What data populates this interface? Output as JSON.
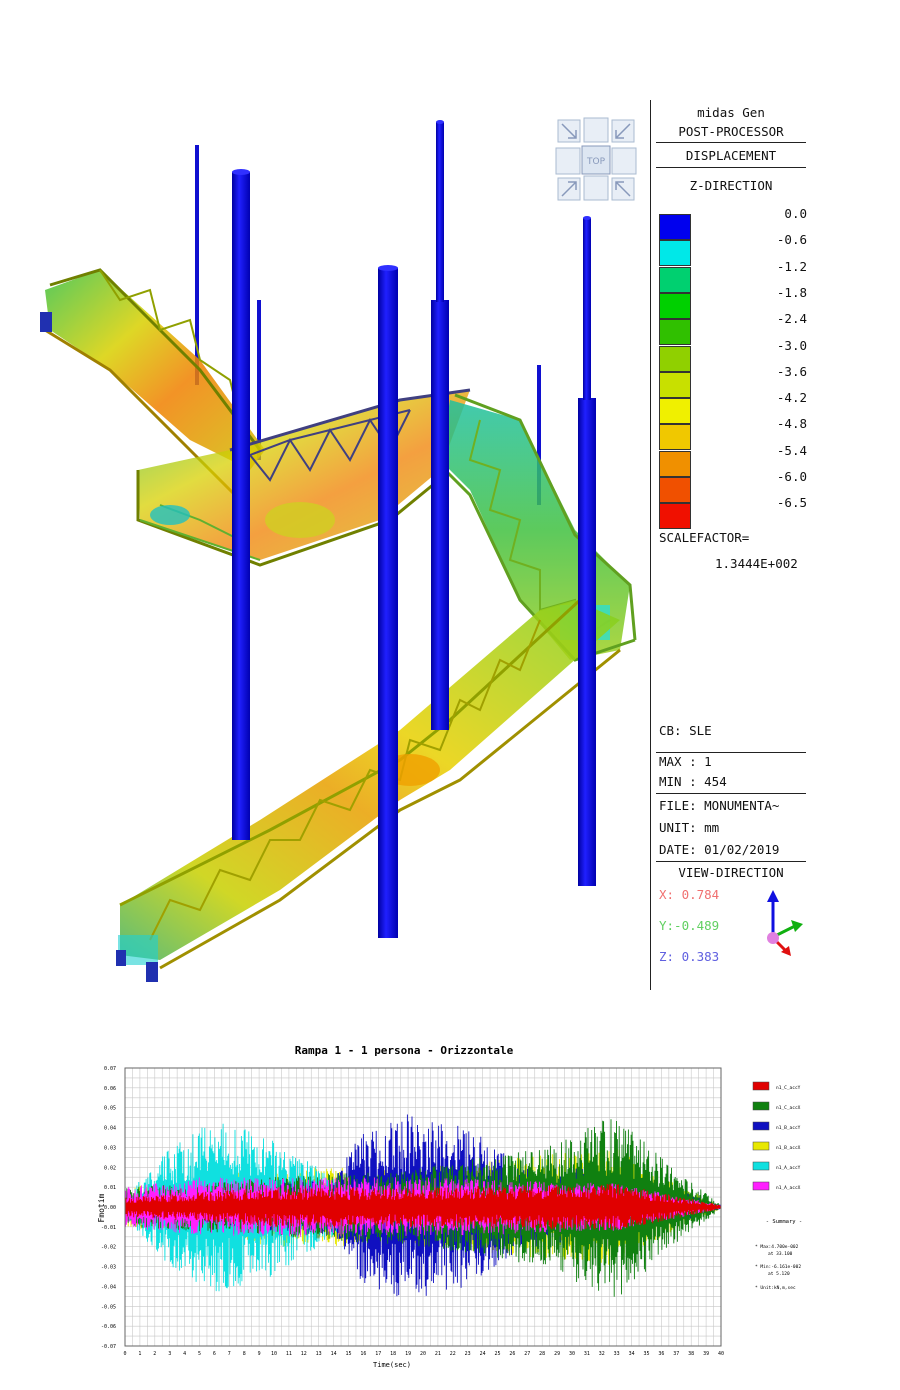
{
  "panel": {
    "app_name": "midas Gen",
    "mode": "POST-PROCESSOR",
    "result_type": "DISPLACEMENT",
    "component": "Z-DIRECTION",
    "contour_values": [
      "0.0",
      "-0.6",
      "-1.2",
      "-1.8",
      "-2.4",
      "-3.0",
      "-3.6",
      "-4.2",
      "-4.8",
      "-5.4",
      "-6.0",
      "-6.5"
    ],
    "contour_colors": [
      "#0000ee",
      "#00e8e8",
      "#00d070",
      "#00d000",
      "#30c000",
      "#90d000",
      "#c8e000",
      "#f0f000",
      "#f0c800",
      "#f09000",
      "#f05000",
      "#f01000"
    ],
    "scalefactor_label": "SCALEFACTOR=",
    "scalefactor_value": "1.3444E+002",
    "cb": "CB: SLE",
    "max": "MAX : 1",
    "min": "MIN : 454",
    "file": "FILE: MONUMENTA~",
    "unit": "UNIT: mm",
    "date": "DATE: 01/02/2019",
    "view_direction": "VIEW-DIRECTION",
    "view_x": "X: 0.784",
    "view_y": "Y:-0.489",
    "view_z": "Z: 0.383",
    "view_cube_label": "TOP"
  },
  "chart_data": {
    "type": "line",
    "title": "Rampa 1 - 1 persona - Orizzontale",
    "xlabel": "Time(sec)",
    "ylabel": "Fmotim",
    "xlim": [
      0,
      40
    ],
    "ylim": [
      -0.07,
      0.07
    ],
    "x_ticks": [
      "0",
      "1",
      "2",
      "3",
      "4",
      "5",
      "6",
      "7",
      "8",
      "9",
      "10",
      "11",
      "12",
      "13",
      "14",
      "15",
      "16",
      "17",
      "18",
      "19",
      "20",
      "21",
      "22",
      "23",
      "24",
      "25",
      "26",
      "27",
      "28",
      "29",
      "30",
      "31",
      "32",
      "33",
      "34",
      "35",
      "36",
      "37",
      "38",
      "39",
      "40"
    ],
    "y_ticks": [
      "0.07",
      "0.06",
      "0.05",
      "0.04",
      "0.03",
      "0.02",
      "0.01",
      "0.00",
      "-0.01",
      "-0.02",
      "-0.03",
      "-0.04",
      "-0.05",
      "-0.06",
      "-0.07"
    ],
    "series": [
      {
        "name": "n1_C_accY",
        "color": "#e00000",
        "envelope": [
          [
            0,
            0.005
          ],
          [
            10,
            0.01
          ],
          [
            20,
            0.01
          ],
          [
            33,
            0.012
          ],
          [
            40,
            0.001
          ]
        ]
      },
      {
        "name": "n1_C_accX",
        "color": "#108010",
        "envelope": [
          [
            0,
            0.01
          ],
          [
            10,
            0.015
          ],
          [
            20,
            0.02
          ],
          [
            28,
            0.03
          ],
          [
            33,
            0.047
          ],
          [
            36,
            0.025
          ],
          [
            40,
            0.001
          ]
        ]
      },
      {
        "name": "n1_B_accY",
        "color": "#1010c0",
        "envelope": [
          [
            0,
            0.005
          ],
          [
            14,
            0.015
          ],
          [
            16,
            0.04
          ],
          [
            19,
            0.047
          ],
          [
            23,
            0.04
          ],
          [
            27,
            0.02
          ],
          [
            33,
            0.02
          ],
          [
            40,
            0.001
          ]
        ]
      },
      {
        "name": "n1_B_accX",
        "color": "#e8e800",
        "envelope": [
          [
            0,
            0.01
          ],
          [
            10,
            0.02
          ],
          [
            20,
            0.02
          ],
          [
            33,
            0.03
          ],
          [
            36,
            0.015
          ],
          [
            40,
            0.001
          ]
        ]
      },
      {
        "name": "n1_A_accY",
        "color": "#10e0e0",
        "envelope": [
          [
            0,
            0.005
          ],
          [
            3,
            0.03
          ],
          [
            6,
            0.044
          ],
          [
            10,
            0.035
          ],
          [
            14,
            0.015
          ],
          [
            20,
            0.01
          ],
          [
            40,
            0.001
          ]
        ]
      },
      {
        "name": "n1_A_accX",
        "color": "#ff20ff",
        "envelope": [
          [
            0,
            0.01
          ],
          [
            5,
            0.015
          ],
          [
            20,
            0.015
          ],
          [
            33,
            0.012
          ],
          [
            40,
            0.001
          ]
        ]
      }
    ],
    "summary_title": "- Summary -",
    "summary_lines": [
      "* Max:4.700e-002",
      "at 33.100",
      "* Min:-6.161e-002",
      "at 5.120",
      "* Unit:kN,m,sec"
    ]
  }
}
